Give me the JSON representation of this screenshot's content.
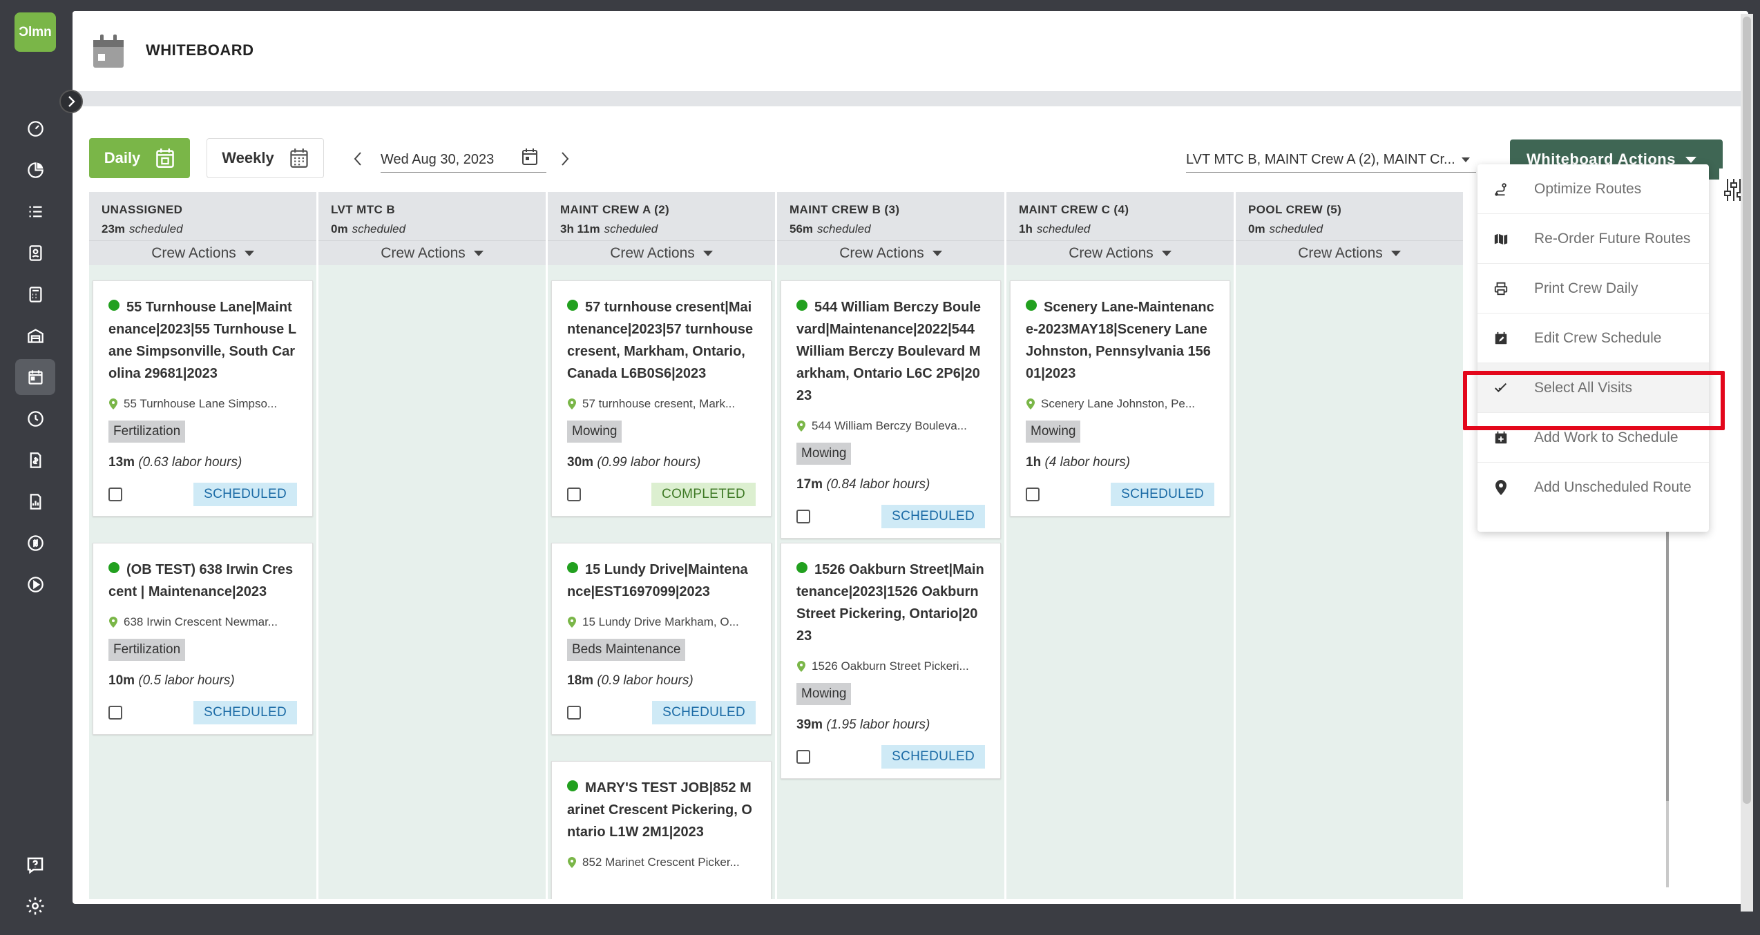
{
  "app": {
    "logo_text": "Ɔlmn",
    "title": "WHITEBOARD"
  },
  "sidebar": {
    "icons": [
      "dashboard-icon",
      "reports-pie-icon",
      "list-icon",
      "contacts-icon",
      "calculator-icon",
      "warehouse-icon",
      "calendar-icon",
      "clock-icon",
      "invoice-icon",
      "report-icon",
      "quickbooks-icon",
      "play-icon"
    ],
    "bottom_icons": [
      "help-icon",
      "settings-icon"
    ]
  },
  "toolbar": {
    "daily_label": "Daily",
    "weekly_label": "Weekly",
    "date_value": "Wed Aug 30, 2023",
    "crew_filter_value": "LVT MTC B, MAINT Crew A (2), MAINT Cr...",
    "actions_label": "Whiteboard Actions"
  },
  "columns": [
    {
      "name": "UNASSIGNED",
      "time": "23m",
      "sched_label": "scheduled",
      "actions_label": "Crew Actions"
    },
    {
      "name": "LVT MTC B",
      "time": "0m",
      "sched_label": "scheduled",
      "actions_label": "Crew Actions"
    },
    {
      "name": "MAINT CREW A (2)",
      "time": "3h 11m",
      "sched_label": "scheduled",
      "actions_label": "Crew Actions"
    },
    {
      "name": "MAINT CREW B (3)",
      "time": "56m",
      "sched_label": "scheduled",
      "actions_label": "Crew Actions"
    },
    {
      "name": "MAINT CREW C (4)",
      "time": "1h",
      "sched_label": "scheduled",
      "actions_label": "Crew Actions"
    },
    {
      "name": "POOL CREW (5)",
      "time": "0m",
      "sched_label": "scheduled",
      "actions_label": "Crew Actions"
    }
  ],
  "cards": {
    "c0a": {
      "title": "55 Turnhouse Lane|Maintenance|2023|55 Turnhouse Lane Simpsonville, South Carolina 29681|2023",
      "address": "55 Turnhouse Lane Simpso...",
      "tag": "Fertilization",
      "duration": "13m",
      "labor": "(0.63 labor hours)",
      "status": "SCHEDULED"
    },
    "c0b": {
      "title": "(OB TEST) 638 Irwin Crescent | Maintenance|2023",
      "address": "638 Irwin Crescent Newmar...",
      "tag": "Fertilization",
      "duration": "10m",
      "labor": "(0.5 labor hours)",
      "status": "SCHEDULED"
    },
    "c2a": {
      "title": "57 turnhouse cresent|Maintenance|2023|57 turnhouse cresent, Markham, Ontario, Canada L6B0S6|2023",
      "address": "57 turnhouse cresent, Mark...",
      "tag": "Mowing",
      "duration": "30m",
      "labor": "(0.99 labor hours)",
      "status": "COMPLETED"
    },
    "c2b": {
      "title": "15 Lundy Drive|Maintenance|EST1697099|2023",
      "address": "15 Lundy Drive Markham, O...",
      "tag": "Beds Maintenance",
      "duration": "18m",
      "labor": "(0.9 labor hours)",
      "status": "SCHEDULED"
    },
    "c2c": {
      "title": "MARY'S TEST JOB|852 Marinet Crescent Pickering, Ontario L1W 2M1|2023",
      "address": "852 Marinet Crescent Picker..."
    },
    "c3a": {
      "title": "544 William Berczy Boulevard|Maintenance|2022|544 William Berczy Boulevard Markham, Ontario L6C 2P6|2023",
      "address": "544 William Berczy Bouleva...",
      "tag": "Mowing",
      "duration": "17m",
      "labor": "(0.84 labor hours)",
      "status": "SCHEDULED"
    },
    "c3b": {
      "title": "1526 Oakburn Street|Maintenance|2023|1526 Oakburn Street Pickering, Ontario|2023",
      "address": "1526 Oakburn Street Pickeri...",
      "tag": "Mowing",
      "duration": "39m",
      "labor": "(1.95 labor hours)",
      "status": "SCHEDULED"
    },
    "c4a": {
      "title": "Scenery Lane-Maintenance-2023MAY18|Scenery Lane Johnston, Pennsylvania 15601|2023",
      "address": "Scenery Lane Johnston, Pe...",
      "tag": "Mowing",
      "duration": "1h",
      "labor": "(4 labor hours)",
      "status": "SCHEDULED"
    }
  },
  "menu": {
    "items": [
      {
        "label": "Optimize Routes",
        "icon": "route-icon"
      },
      {
        "label": "Re-Order Future Routes",
        "icon": "map-icon"
      },
      {
        "label": "Print Crew Daily",
        "icon": "print-icon"
      },
      {
        "label": "Edit Crew Schedule",
        "icon": "calendar-edit-icon"
      },
      {
        "label": "Select All Visits",
        "icon": "check-icon"
      },
      {
        "label": "Add Work to Schedule",
        "icon": "calendar-add-icon"
      },
      {
        "label": "Add Unscheduled Route",
        "icon": "location-pin-icon"
      }
    ],
    "highlighted": "Select All Visits"
  },
  "colors": {
    "brand_green": "#7ab648",
    "actions_green": "#3f6654",
    "status_dot": "#22a01f",
    "scheduled_bg": "#cfeaf6",
    "completed_bg": "#dcefd0",
    "highlight_red": "#e3071b"
  }
}
